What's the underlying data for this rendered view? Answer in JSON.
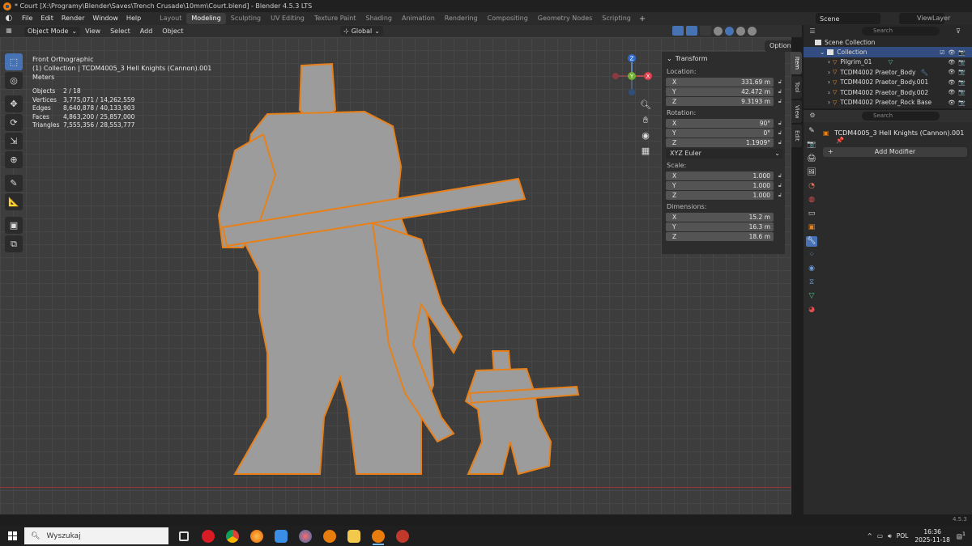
{
  "window": {
    "title": "* Court [X:\\Programy\\Blender\\Saves\\Trench Crusade\\10mm\\Court.blend] - Blender 4.5.3 LTS"
  },
  "menu": [
    "File",
    "Edit",
    "Render",
    "Window",
    "Help"
  ],
  "workspaces": [
    "Layout",
    "Modeling",
    "Sculpting",
    "UV Editing",
    "Texture Paint",
    "Shading",
    "Animation",
    "Rendering",
    "Compositing",
    "Geometry Nodes",
    "Scripting"
  ],
  "active_workspace": "Modeling",
  "scene": {
    "name": "Scene",
    "view_layer": "ViewLayer"
  },
  "viewport_header": {
    "mode": "Object Mode",
    "menus": [
      "View",
      "Select",
      "Add",
      "Object"
    ],
    "orientation": "Global",
    "options": "Options"
  },
  "viewport": {
    "view_name": "Front Orthographic",
    "collection_line": "(1) Collection | TCDM4005_3 Hell Knights (Cannon).001",
    "units": "Meters",
    "stats": [
      {
        "label": "Objects",
        "value": "2 / 18"
      },
      {
        "label": "Vertices",
        "value": "3,775,071 / 14,262,559"
      },
      {
        "label": "Edges",
        "value": "8,640,878 / 40,133,903"
      },
      {
        "label": "Faces",
        "value": "4,863,200 / 25,857,000"
      },
      {
        "label": "Triangles",
        "value": "7,555,356 / 28,553,777"
      }
    ],
    "gizmo": {
      "z": "Z",
      "y": "Y",
      "x": "X"
    }
  },
  "npanel": {
    "header": "Transform",
    "location_label": "Location:",
    "location": {
      "x": "331.69 m",
      "y": "42.472 m",
      "z": "9.3193 m"
    },
    "rotation_label": "Rotation:",
    "rotation": {
      "x": "90°",
      "y": "0°",
      "z": "1.1909°"
    },
    "rotation_mode": "XYZ Euler",
    "scale_label": "Scale:",
    "scale": {
      "x": "1.000",
      "y": "1.000",
      "z": "1.000"
    },
    "dimensions_label": "Dimensions:",
    "dimensions": {
      "x": "15.2 m",
      "y": "16.3 m",
      "z": "18.6 m"
    },
    "axis": {
      "x": "X",
      "y": "Y",
      "z": "Z"
    },
    "tabs": [
      "Item",
      "Tool",
      "View",
      "Edit"
    ]
  },
  "outliner": {
    "search_placeholder": "Search",
    "root": "Scene Collection",
    "collection": "Collection",
    "items": [
      "Pilgrim_01",
      "TCDM4002 Praetor_Body",
      "TCDM4002 Praetor_Body.001",
      "TCDM4002 Praetor_Body.002",
      "TCDM4002 Praetor_Rock Base"
    ]
  },
  "properties": {
    "search_placeholder": "Search",
    "object_name": "TCDM4005_3 Hell Knights (Cannon).001",
    "add_modifier": "Add Modifier"
  },
  "version": "4.5.3",
  "taskbar": {
    "search_placeholder": "Wyszukaj",
    "language": "POL",
    "time": "16:36",
    "date": "2025-11-18",
    "notifications": "1"
  },
  "colors": {
    "accent": "#4772b3",
    "selection_outline": "#e8801a",
    "ground_line": "#9a3535",
    "viewport_bg": "#3d3d3d"
  }
}
